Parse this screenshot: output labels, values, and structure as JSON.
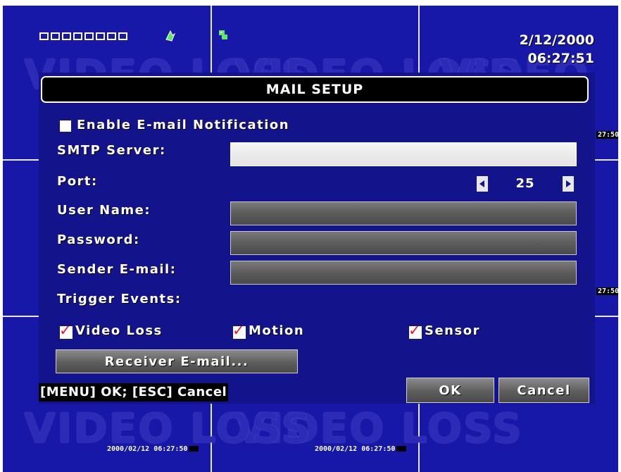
{
  "clock": {
    "date": "2/12/2000",
    "time": "06:27:51"
  },
  "cam_timestamps": [
    "2000/02/12 06:27:50",
    "2000/02/12 06:27:50"
  ],
  "side_times": [
    "27:50",
    "27:50"
  ],
  "logo_text": "VIDEO LOSS",
  "dialog": {
    "title": "MAIL SETUP",
    "enable_label": "Enable E-mail Notification",
    "smtp_label": "SMTP Server:",
    "smtp_value": "",
    "port_label": "Port:",
    "port_value": "25",
    "username_label": "User Name:",
    "username_value": "",
    "password_label": "Password:",
    "password_value": "",
    "sender_label": "Sender E-mail:",
    "sender_value": "",
    "trigger_label": "Trigger Events:",
    "events": [
      {
        "label": "Video Loss",
        "checked": true
      },
      {
        "label": "Motion",
        "checked": true
      },
      {
        "label": "Sensor",
        "checked": true
      }
    ],
    "receiver_button": "Receiver E-mail...",
    "help_text": "[MENU] OK; [ESC] Cancel",
    "ok_button": "OK",
    "cancel_button": "Cancel"
  },
  "icons": {
    "left_arrow": "left-arrow-icon",
    "right_arrow": "right-arrow-icon",
    "checkmark": "check-icon"
  },
  "colors": {
    "screen_bg": "#1717a8",
    "dialog_bg": "#13138c",
    "checkmark": "#e02020",
    "status_icon": "#5eea5e"
  }
}
